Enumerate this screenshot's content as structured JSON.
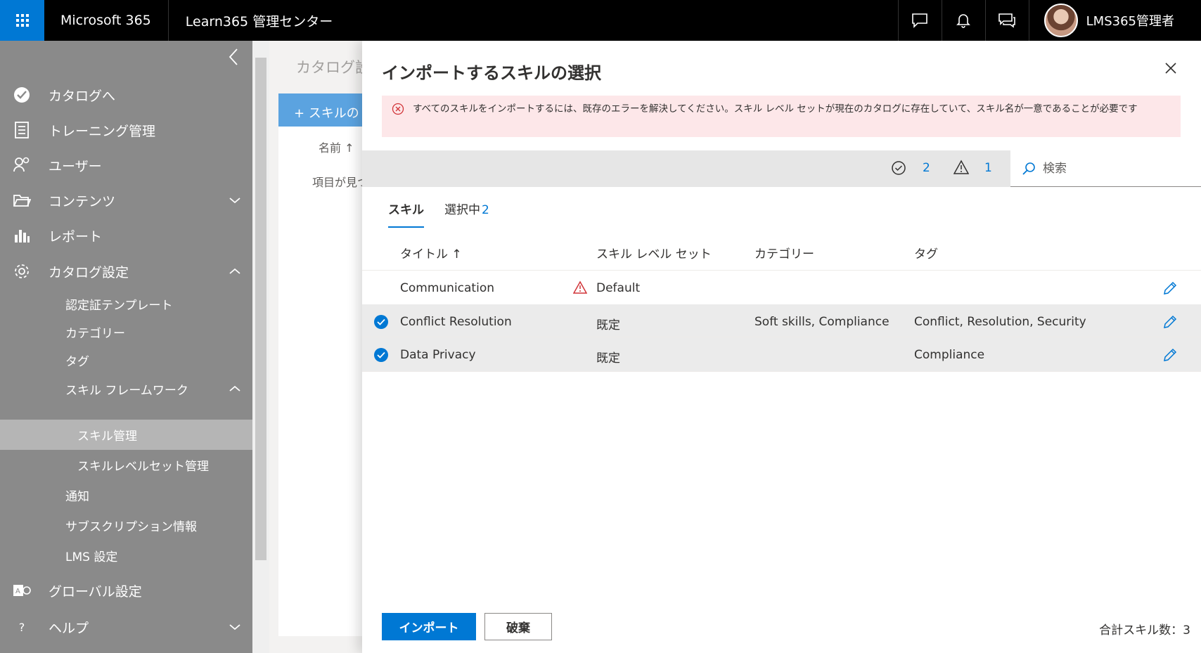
{
  "topbar": {
    "brand": "Microsoft 365",
    "app_title": "Learn365 管理センター",
    "user_name": "LMS365管理者",
    "icons": [
      "chat-icon",
      "bell-icon",
      "feedback-icon"
    ]
  },
  "sidebar": {
    "items": [
      {
        "label": "カタログへ",
        "icon": "catalog-icon"
      },
      {
        "label": "トレーニング管理",
        "icon": "training-icon"
      },
      {
        "label": "ユーザー",
        "icon": "users-icon"
      },
      {
        "label": "コンテンツ",
        "icon": "folder-icon"
      },
      {
        "label": "レポート",
        "icon": "chart-icon"
      },
      {
        "label": "カタログ設定",
        "icon": "gear-icon"
      }
    ],
    "sub_items": [
      {
        "label": "認定証テンプレート"
      },
      {
        "label": "カテゴリー"
      },
      {
        "label": "タグ"
      },
      {
        "label": "スキル フレームワーク"
      },
      {
        "label": "スキル管理"
      },
      {
        "label": "スキルレベルセット管理"
      },
      {
        "label": "通知"
      },
      {
        "label": "サブスクリプション情報"
      },
      {
        "label": "LMS 設定"
      }
    ],
    "bottom_items": [
      {
        "label": "グローバル設定",
        "icon": "global-settings-icon"
      },
      {
        "label": "ヘルプ",
        "icon": "help-icon"
      }
    ]
  },
  "background_page": {
    "title": "カタログ設定",
    "add_button": "+ スキルの",
    "column_name": "名前 ↑",
    "empty_text": "項目が見つかりません"
  },
  "panel": {
    "title": "インポートするスキルの選択",
    "error_message": "すべてのスキルをインポートするには、既存のエラーを解決してください。スキル レベル セットが現在のカタログに存在していて、スキル名が一意であることが必要です",
    "valid_count": "2",
    "warning_count": "1",
    "search_placeholder": "検索",
    "tabs": {
      "skills": "スキル",
      "selected": "選択中",
      "selected_count": "2"
    },
    "columns": {
      "title": "タイトル ↑",
      "level_set": "スキル レベル セット",
      "category": "カテゴリー",
      "tags": "タグ"
    },
    "rows": [
      {
        "title": "Communication",
        "level_set": "Default",
        "category": "",
        "tags": "",
        "selected": false,
        "warning": true
      },
      {
        "title": "Conflict Resolution",
        "level_set": "既定",
        "category": "Soft skills, Compliance",
        "tags": "Conflict, Resolution, Security",
        "selected": true,
        "warning": false
      },
      {
        "title": "Data Privacy",
        "level_set": "既定",
        "category": "",
        "tags": "Compliance",
        "selected": true,
        "warning": false
      }
    ],
    "import_button": "インポート",
    "discard_button": "破棄",
    "total_label": "合計スキル数：3"
  },
  "colors": {
    "accent": "#0078d4",
    "error_bg": "#fde7e9",
    "error_icon": "#d13438",
    "sidebar_bg": "#8a8a8a"
  }
}
